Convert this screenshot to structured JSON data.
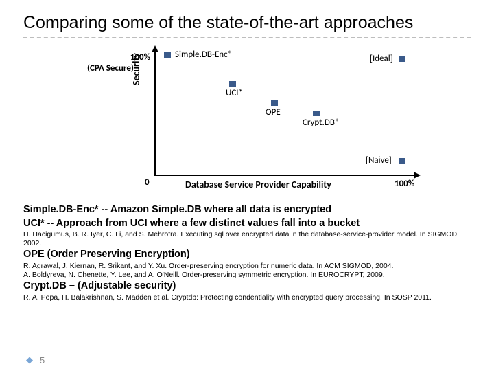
{
  "title": "Comparing some of the state-of-the-art approaches",
  "chart_data": {
    "type": "scatter",
    "xlabel": "Database Service Provider Capability",
    "ylabel": "Security",
    "xlim": [
      0,
      100
    ],
    "ylim": [
      0,
      100
    ],
    "x_ticks": [
      "0",
      "100%"
    ],
    "y_ticks": [
      "100%"
    ],
    "y_note": "(CPA Secure)",
    "series": [
      {
        "name": "Simple.DB-Enc*",
        "x": 5,
        "y": 98
      },
      {
        "name": "UCI*",
        "x": 30,
        "y": 74
      },
      {
        "name": "OPE",
        "x": 46,
        "y": 58
      },
      {
        "name": "Crypt.DB*",
        "x": 62,
        "y": 50
      },
      {
        "name": "[Ideal]",
        "x": 95,
        "y": 95
      },
      {
        "name": "[Naive]",
        "x": 95,
        "y": 12
      }
    ]
  },
  "notes": {
    "line1": "Simple.DB-Enc* -- Amazon Simple.DB where all data is encrypted",
    "line2": "UCI* -- Approach  from UCI where a few distinct values fall into a bucket",
    "ref1": "H. Hacigumus, B. R. Iyer, C. Li, and S. Mehrotra. Executing sql over encrypted data in the database-service-provider model. In SIGMOD, 2002.",
    "line3": "OPE (Order Preserving Encryption)",
    "ref2": "R. Agrawal, J. Kiernan, R. Srikant, and Y. Xu. Order-preserving encryption for numeric data. In ACM SIGMOD, 2004.",
    "ref3": "A. Boldyreva, N. Chenette, Y. Lee, and A. O'Neill. Order-preserving symmetric encryption. In EUROCRYPT, 2009.",
    "line4": "Crypt.DB – (Adjustable security)",
    "ref4": "R. A. Popa, H. Balakrishnan, S. Madden et al. Cryptdb: Protecting condentiality with encrypted query processing. In SOSP 2011."
  },
  "page": "5"
}
